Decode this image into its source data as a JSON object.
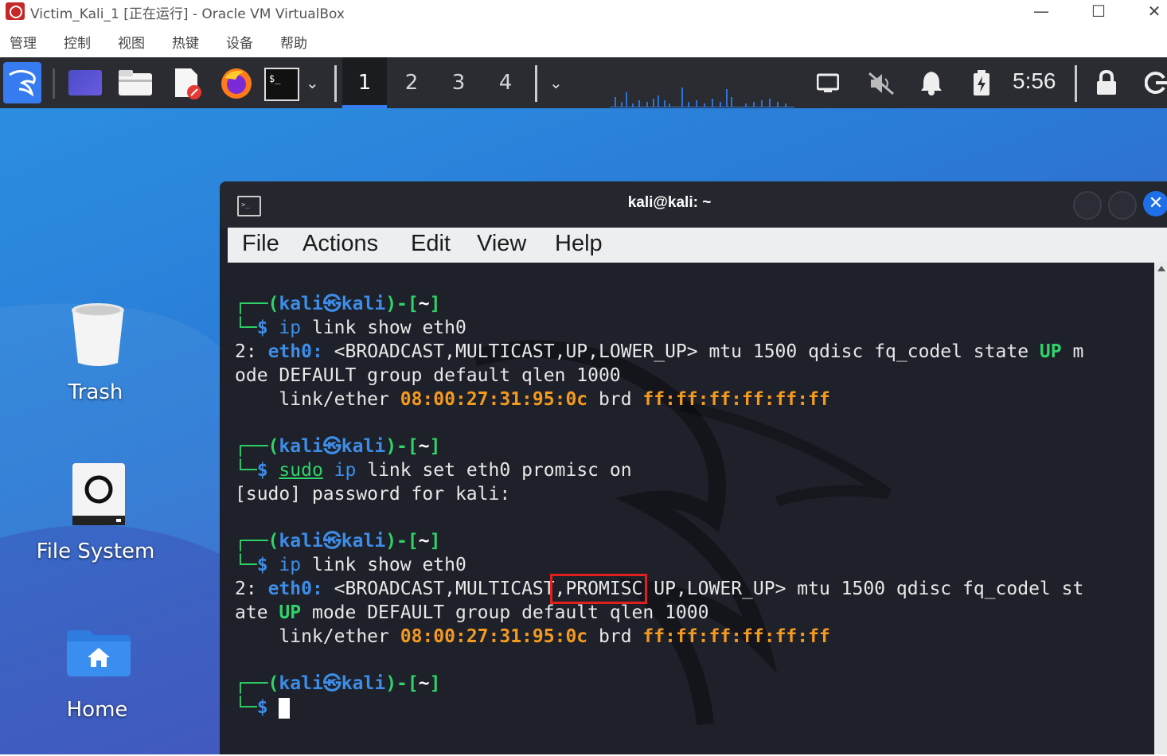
{
  "host": {
    "title": "Victim_Kali_1 [正在运行] - Oracle VM VirtualBox",
    "menu": [
      "管理",
      "控制",
      "视图",
      "热键",
      "设备",
      "帮助"
    ]
  },
  "panel": {
    "workspaces": [
      "1",
      "2",
      "3",
      "4"
    ],
    "active_workspace": "1",
    "clock": "5:56"
  },
  "desktop": {
    "icons": [
      {
        "label": "Trash",
        "icon": "trash-icon"
      },
      {
        "label": "File System",
        "icon": "drive-icon"
      },
      {
        "label": "Home",
        "icon": "home-folder-icon"
      }
    ]
  },
  "terminal": {
    "title": "kali@kali: ~",
    "menu": [
      "File",
      "Actions",
      "Edit",
      "View",
      "Help"
    ],
    "prompt": {
      "user": "kali",
      "host": "kali",
      "dir": "~"
    },
    "commands": {
      "c1": "ip link show eth0",
      "c2_sudo": "sudo",
      "c2_rest": "link set eth0 promisc on",
      "c3": "ip link show eth0"
    },
    "output": {
      "l1_idx": "2:",
      "iface": "eth0:",
      "l1_flags": "<BROADCAST,MULTICAST,UP,LOWER_UP> mtu 1500 qdisc fq_codel state",
      "up": "UP",
      "l1_tail": "m",
      "l2": "ode DEFAULT group default qlen 1000",
      "ether_label": "link/ether",
      "mac": "08:00:27:31:95:0c",
      "brd": "brd",
      "bcast": "ff:ff:ff:ff:ff:ff",
      "sudo_pw": "[sudo] password for kali:",
      "l3_pre": "<BROADCAST,MULTICAST",
      "promisc": ",PROMISC",
      "l3_post": "UP,LOWER_UP> mtu 1500 qdisc fq_codel st",
      "l4_pre": "ate",
      "l4_post": "mode DEFAULT group default qlen 1000"
    },
    "highlight_color": "#e0201b"
  }
}
